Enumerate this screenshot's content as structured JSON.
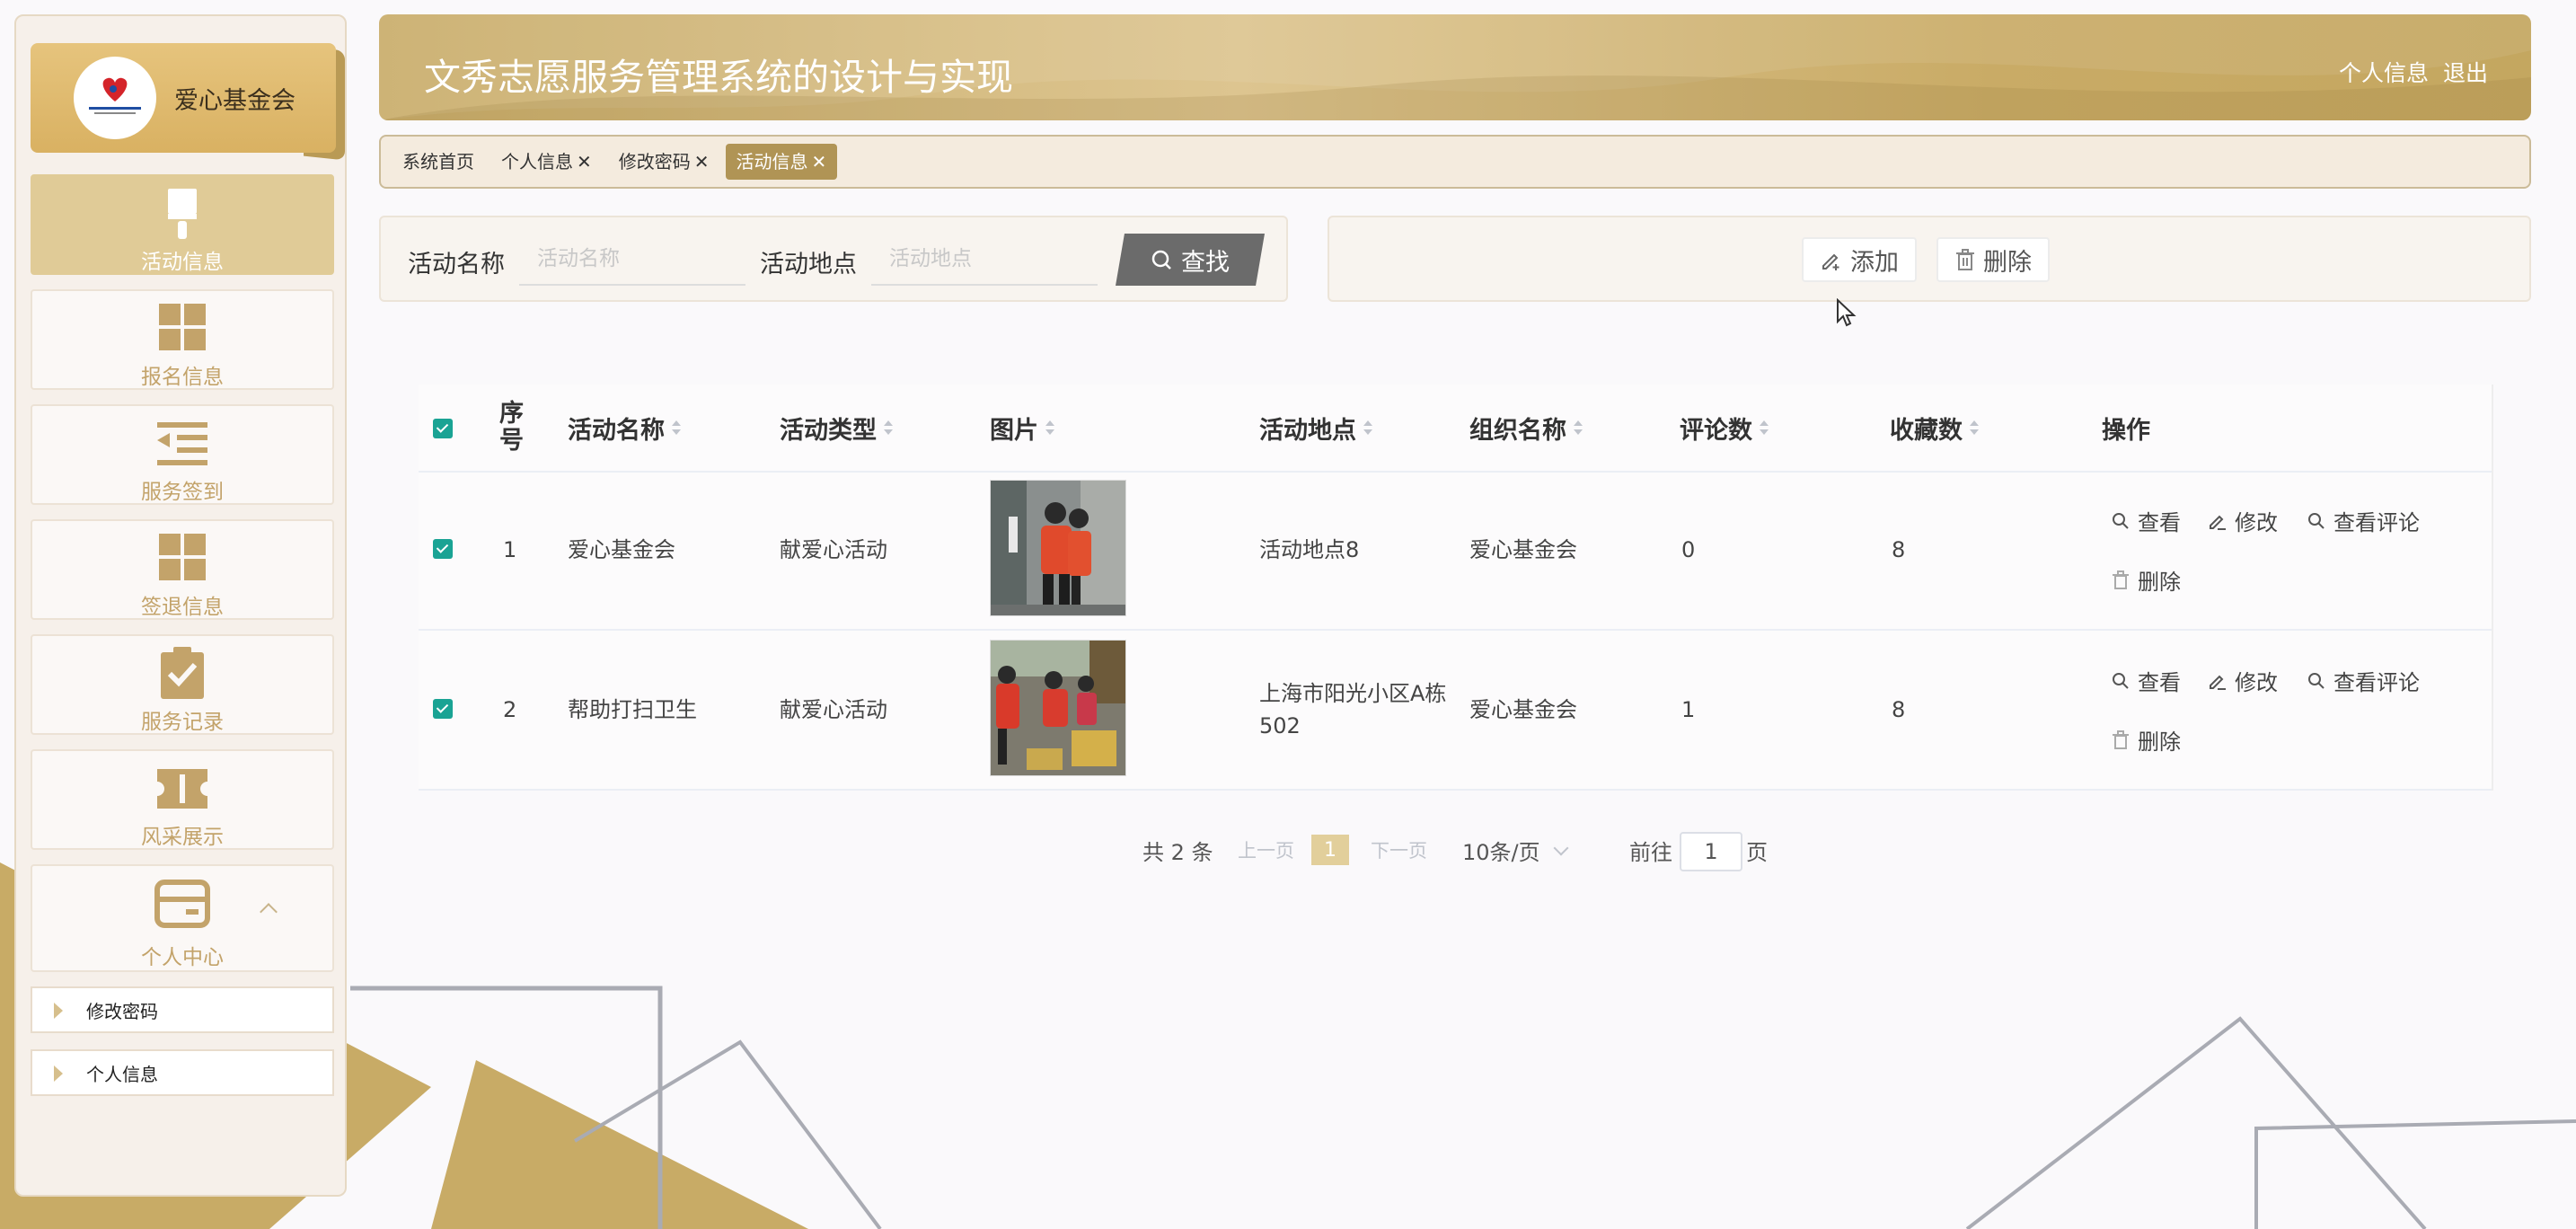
{
  "brand": {
    "title": "爱心基金会"
  },
  "sidebar": {
    "items": [
      {
        "label": "活动信息",
        "icon": "brush-icon",
        "active": true
      },
      {
        "label": "报名信息",
        "icon": "grid-icon"
      },
      {
        "label": "服务签到",
        "icon": "list-indent-icon"
      },
      {
        "label": "签退信息",
        "icon": "grid-icon"
      },
      {
        "label": "服务记录",
        "icon": "clipboard-check-icon"
      },
      {
        "label": "风采展示",
        "icon": "ticket-icon"
      },
      {
        "label": "个人中心",
        "icon": "wallet-icon"
      }
    ],
    "sub_items": [
      {
        "label": "修改密码"
      },
      {
        "label": "个人信息"
      }
    ]
  },
  "header": {
    "title": "文秀志愿服务管理系统的设计与实现",
    "profile_link": "个人信息",
    "logout_link": "退出"
  },
  "tabs": [
    {
      "label": "系统首页",
      "closable": false
    },
    {
      "label": "个人信息",
      "closable": true
    },
    {
      "label": "修改密码",
      "closable": true
    },
    {
      "label": "活动信息",
      "closable": true,
      "active": true
    }
  ],
  "tab_close_glyph": "✕",
  "search": {
    "name_label": "活动名称",
    "name_placeholder": "活动名称",
    "place_label": "活动地点",
    "place_placeholder": "活动地点",
    "button_label": "查找"
  },
  "actions": {
    "add_label": "添加",
    "delete_label": "删除"
  },
  "table": {
    "columns": {
      "index": "序号",
      "name": "活动名称",
      "type": "活动类型",
      "image": "图片",
      "place": "活动地点",
      "org": "组织名称",
      "comments": "评论数",
      "favorites": "收藏数",
      "ops": "操作"
    },
    "rows": [
      {
        "index": "1",
        "name": "爱心基金会",
        "type": "献爱心活动",
        "place": "活动地点8",
        "org": "爱心基金会",
        "comments": "0",
        "favorites": "8"
      },
      {
        "index": "2",
        "name": "帮助打扫卫生",
        "type": "献爱心活动",
        "place": "上海市阳光小区A栋502",
        "org": "爱心基金会",
        "comments": "1",
        "favorites": "8"
      }
    ],
    "ops": {
      "view": "查看",
      "edit": "修改",
      "view_comments": "查看评论",
      "delete": "删除"
    }
  },
  "pagination": {
    "total": "共 2 条",
    "prev": "上一页",
    "current": "1",
    "next": "下一页",
    "page_size": "10条/页",
    "goto": "前往",
    "goto_value": "1",
    "unit": "页"
  },
  "colors": {
    "gold": "#c9ad6b",
    "tab_active": "#b09455",
    "checkbox": "#1aa394",
    "search_button": "#6b6b6b"
  }
}
